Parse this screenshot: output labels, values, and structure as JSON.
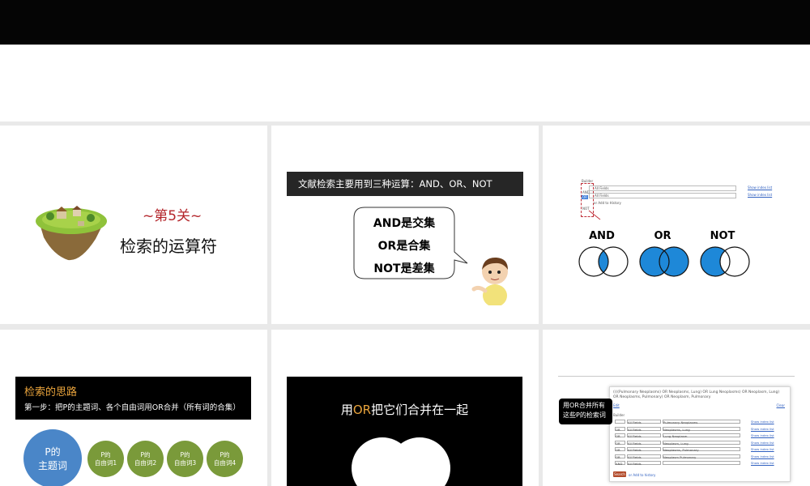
{
  "slides": {
    "s1": {
      "level": "~第5关~",
      "title": "检索的运算符"
    },
    "s2": {
      "banner": "文献检索主要用到三种运算：AND、OR、NOT",
      "bubble": [
        "AND是交集",
        "OR是合集",
        "NOT是差集"
      ]
    },
    "s3": {
      "builder_label": "Builder",
      "rows": [
        {
          "op": "",
          "field": "All Fields",
          "link": "Show index list"
        },
        {
          "op": "AND",
          "field": "All Fields",
          "link": "Show index list"
        }
      ],
      "ops": [
        "AND",
        "OR",
        "NOT"
      ],
      "add_history": "or Add to History",
      "venn": [
        "AND",
        "OR",
        "NOT"
      ],
      "colors": {
        "fill": "#1e88d8",
        "stroke": "#111111"
      }
    },
    "s4": {
      "head_title": "检索的思路",
      "step": "第一步：把P的主题词、各个自由词用OR合并（所有词的合集）",
      "main_circle": [
        "P的",
        "主题词"
      ],
      "free": [
        [
          "P的",
          "自由词1"
        ],
        [
          "P的",
          "自由词2"
        ],
        [
          "P的",
          "自由词3"
        ],
        [
          "P的",
          "自由词4"
        ]
      ],
      "colors": {
        "main": "#4a86c8",
        "free": "#7a9a3a"
      }
    },
    "s5": {
      "pre": "用",
      "op": "OR",
      "post": "把它们合并在一起"
    },
    "s6": {
      "query": "((((Pulmonary Neoplasms) OR Neoplasms, Lung) OR Lung Neoplasms) OR Neoplasm, Lung) OR Neoplasms, Pulmonary) OR Neoplasm, Pulmonary",
      "edit": "Edit",
      "clear": "Clear",
      "builder": "Builder",
      "callout": [
        "用OR合并所有",
        "这些P的检索词"
      ],
      "rows": [
        {
          "op": "",
          "field": "All Fields",
          "term": "Pulmonary Neoplasms",
          "link": "Show index list"
        },
        {
          "op": "OR",
          "field": "All Fields",
          "term": "Neoplasms, Lung",
          "link": "Show index list"
        },
        {
          "op": "OR",
          "field": "All Fields",
          "term": "Lung Neoplasm",
          "link": "Show index list"
        },
        {
          "op": "OR",
          "field": "All Fields",
          "term": "Neoplasm, Lung",
          "link": "Show index list"
        },
        {
          "op": "OR",
          "field": "All Fields",
          "term": "Neoplasms, Pulmonary",
          "link": "Show index list"
        },
        {
          "op": "OR",
          "field": "All Fields",
          "term": "Neoplasm Pulmonary",
          "link": "Show index list"
        },
        {
          "op": "AND",
          "field": "All Fields",
          "term": "",
          "link": "Show index list"
        }
      ],
      "search": "Search",
      "add_history": "or Add to history"
    }
  }
}
